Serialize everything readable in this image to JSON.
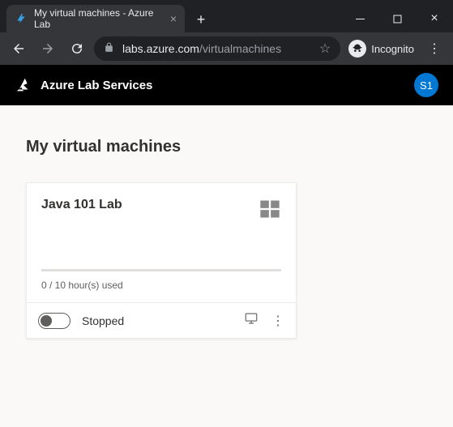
{
  "browser": {
    "tab_title": "My virtual machines - Azure Lab",
    "url_host": "labs.azure.com",
    "url_path": "/virtualmachines",
    "incognito_label": "Incognito"
  },
  "app": {
    "brand": "Azure Lab Services",
    "avatar_initials": "S1"
  },
  "page": {
    "title": "My virtual machines"
  },
  "vm": {
    "name": "Java 101 Lab",
    "os_icon": "windows-icon",
    "usage": "0 / 10 hour(s) used",
    "status": "Stopped",
    "toggle_on": false
  },
  "colors": {
    "accent": "#0078d4"
  }
}
